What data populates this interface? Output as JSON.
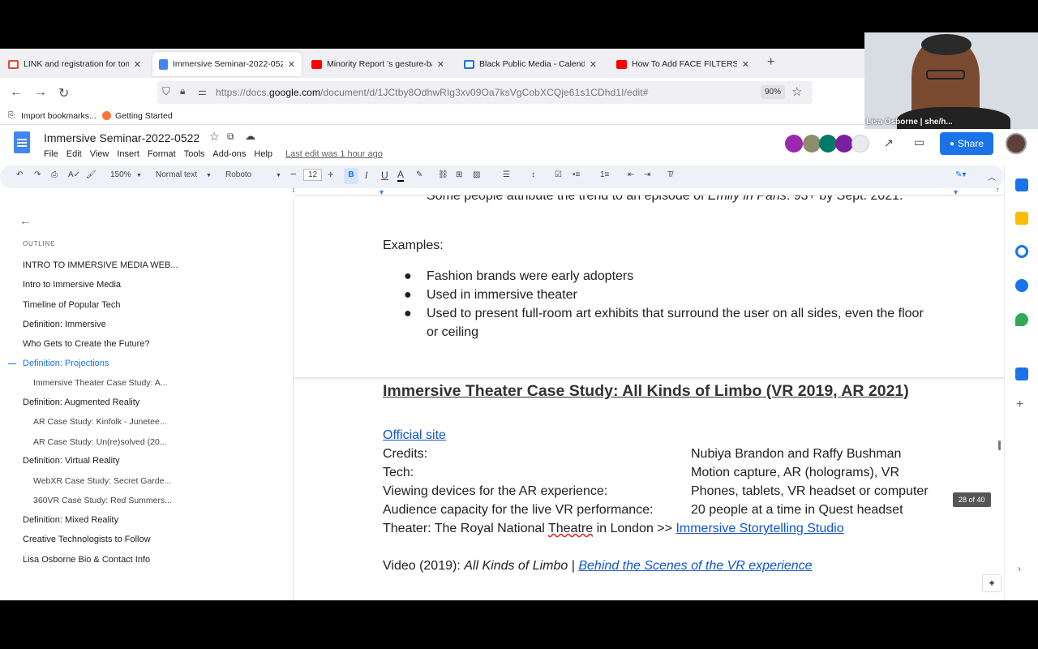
{
  "tabs": [
    {
      "label": "LINK and registration for tomor",
      "icon": "gmail-icon",
      "color": "#ea4335"
    },
    {
      "label": "Immersive Seminar-2022-0522",
      "icon": "docs-icon",
      "color": "#4285f4"
    },
    {
      "label": "Minority Report 's gesture-base",
      "icon": "youtube-icon",
      "color": "#ff0000"
    },
    {
      "label": "Black Public Media - Calendar",
      "icon": "calendar-icon",
      "color": "#1a73e8"
    },
    {
      "label": "How To Add FACE FILTERS in O",
      "icon": "youtube-icon",
      "color": "#ff0000"
    }
  ],
  "nav": {
    "url_prefix": "https://docs.",
    "url_domain": "google.com",
    "url_suffix": "/document/d/1JCtby8OdhwRIg3xv09Oa7ksVgCobXCQje61s1CDhd1I/edit#",
    "zoom": "90%"
  },
  "bookmarks": {
    "import": "Import bookmarks...",
    "getting_started": "Getting Started"
  },
  "docs": {
    "title": "Immersive Seminar-2022-0522",
    "menus": [
      "File",
      "Edit",
      "View",
      "Insert",
      "Format",
      "Tools",
      "Add-ons",
      "Help"
    ],
    "last_edit": "Last edit was 1 hour ago",
    "share": "Share"
  },
  "toolbar": {
    "zoom": "150%",
    "style": "Normal text",
    "font": "Roboto",
    "size": "12"
  },
  "ruler": {
    "left": "1",
    "right": "7"
  },
  "outline": {
    "heading": "OUTLINE",
    "items": [
      {
        "label": "INTRO TO IMMERSIVE MEDIA WEB...",
        "level": 1
      },
      {
        "label": "Intro to Immersive Media",
        "level": 1
      },
      {
        "label": "Timeline of Popular Tech",
        "level": 1
      },
      {
        "label": "Definition: Immersive",
        "level": 1
      },
      {
        "label": "Who Gets to Create the Future?",
        "level": 1
      },
      {
        "label": "Definition: Projections",
        "level": 1,
        "active": true
      },
      {
        "label": "Immersive Theater Case Study: A...",
        "level": 2
      },
      {
        "label": "Definition: Augmented Reality",
        "level": 1
      },
      {
        "label": "AR Case Study: Kinfolk - Junetee...",
        "level": 2
      },
      {
        "label": "AR Case Study: Un(re)solved (20...",
        "level": 2
      },
      {
        "label": "Definition: Virtual Reality",
        "level": 1
      },
      {
        "label": "WebXR Case Study: Secret Garde...",
        "level": 2
      },
      {
        "label": "360VR Case Study: Red Summers...",
        "level": 2
      },
      {
        "label": "Definition: Mixed Reality",
        "level": 1
      },
      {
        "label": "Creative Technologists to Follow",
        "level": 1
      },
      {
        "label": "Lisa Osborne Bio & Contact Info",
        "level": 1
      }
    ]
  },
  "document": {
    "top_line": "Some people attribute the trend to an episode of",
    "top_line_em": "Emily in Paris",
    "top_line_end": ". 93+ by Sept. 2021.",
    "examples_label": "Examples:",
    "bullets": [
      "Fashion brands were early adopters",
      "Used in immersive theater",
      "Used to present full-room art exhibits that surround the user on all sides, even the floor",
      "or ceiling"
    ],
    "heading": "Immersive Theater Case Study: All Kinds of Limbo (VR 2019, AR 2021)",
    "official_site": "Official site",
    "rows": [
      {
        "label": "Credits:",
        "value": "Nubiya Brandon and Raffy Bushman"
      },
      {
        "label": "Tech:",
        "value": "Motion capture, AR (holograms), VR"
      },
      {
        "label": "Viewing devices for the AR experience:",
        "value": "Phones, tablets, VR headset or computer"
      },
      {
        "label": "Audience capacity for the live VR performance:",
        "value": "20 people at a time in Quest headset"
      }
    ],
    "theater_line": "Theater: The Royal National",
    "theater_word": "Theatre",
    "theater_end": "in London >>",
    "theater_link": "Immersive Storytelling Studio",
    "video_prefix": "Video (2019):",
    "video_em": "All Kinds of Limbo",
    "video_sep": "|",
    "video_link": "Behind the Scenes of the VR experience"
  },
  "page_badge": "28 of 40",
  "webcam": {
    "name": "Lisa Osborne | she/h..."
  }
}
